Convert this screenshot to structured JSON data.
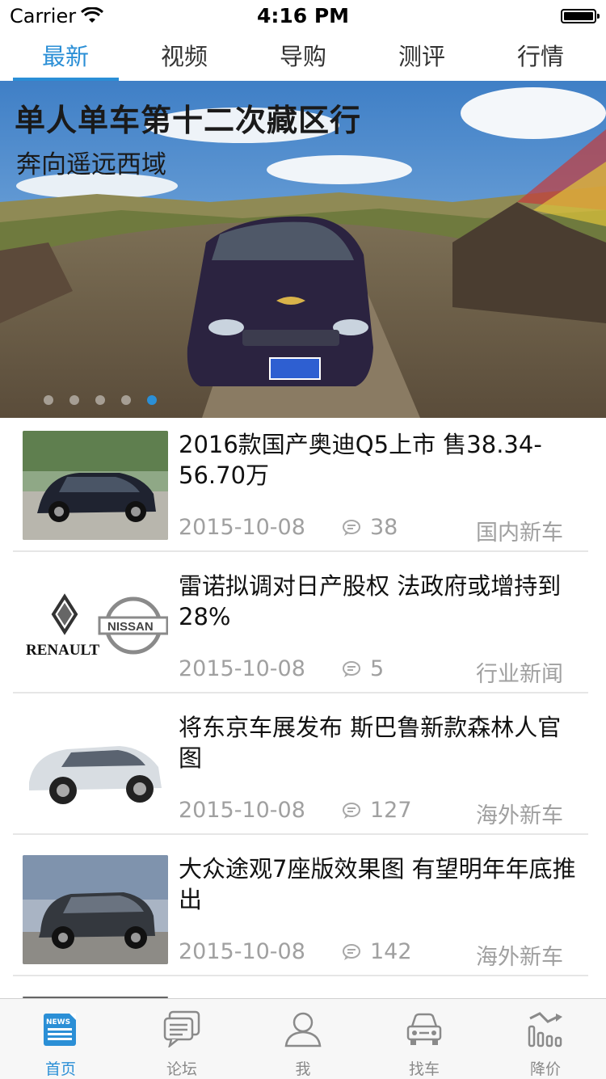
{
  "status_bar": {
    "carrier": "Carrier",
    "time": "4:16 PM"
  },
  "top_tabs": [
    "最新",
    "视频",
    "导购",
    "测评",
    "行情"
  ],
  "banner": {
    "title": "单人单车第十二次藏区行",
    "subtitle": "奔向遥远西域",
    "page_count": 5,
    "active_page": 5
  },
  "news": [
    {
      "title": "2016款国产奥迪Q5上市 售38.34-56.70万",
      "date": "2015-10-08",
      "comments": "38",
      "category": "国内新车"
    },
    {
      "title": "雷诺拟调对日产股权 法政府或增持到28%",
      "date": "2015-10-08",
      "comments": "5",
      "category": "行业新闻"
    },
    {
      "title": "将东京车展发布 斯巴鲁新款森林人官图",
      "date": "2015-10-08",
      "comments": "127",
      "category": "海外新车"
    },
    {
      "title": "大众途观7座版效果图 有望明年年底推出",
      "date": "2015-10-08",
      "comments": "142",
      "category": "海外新车"
    }
  ],
  "logos": {
    "renault": "RENAULT",
    "nissan": "NISSAN",
    "news_icon": "NEWS"
  },
  "tab_bar": [
    {
      "label": "首页",
      "icon": "news-icon",
      "active": true
    },
    {
      "label": "论坛",
      "icon": "chat-icon",
      "active": false
    },
    {
      "label": "我",
      "icon": "person-icon",
      "active": false
    },
    {
      "label": "找车",
      "icon": "car-icon",
      "active": false
    },
    {
      "label": "降价",
      "icon": "price-drop-icon",
      "active": false
    }
  ],
  "colors": {
    "accent": "#2b8fd6",
    "text": "#111111",
    "meta": "#a0a0a0",
    "tab_inactive": "#8a8a8a"
  }
}
